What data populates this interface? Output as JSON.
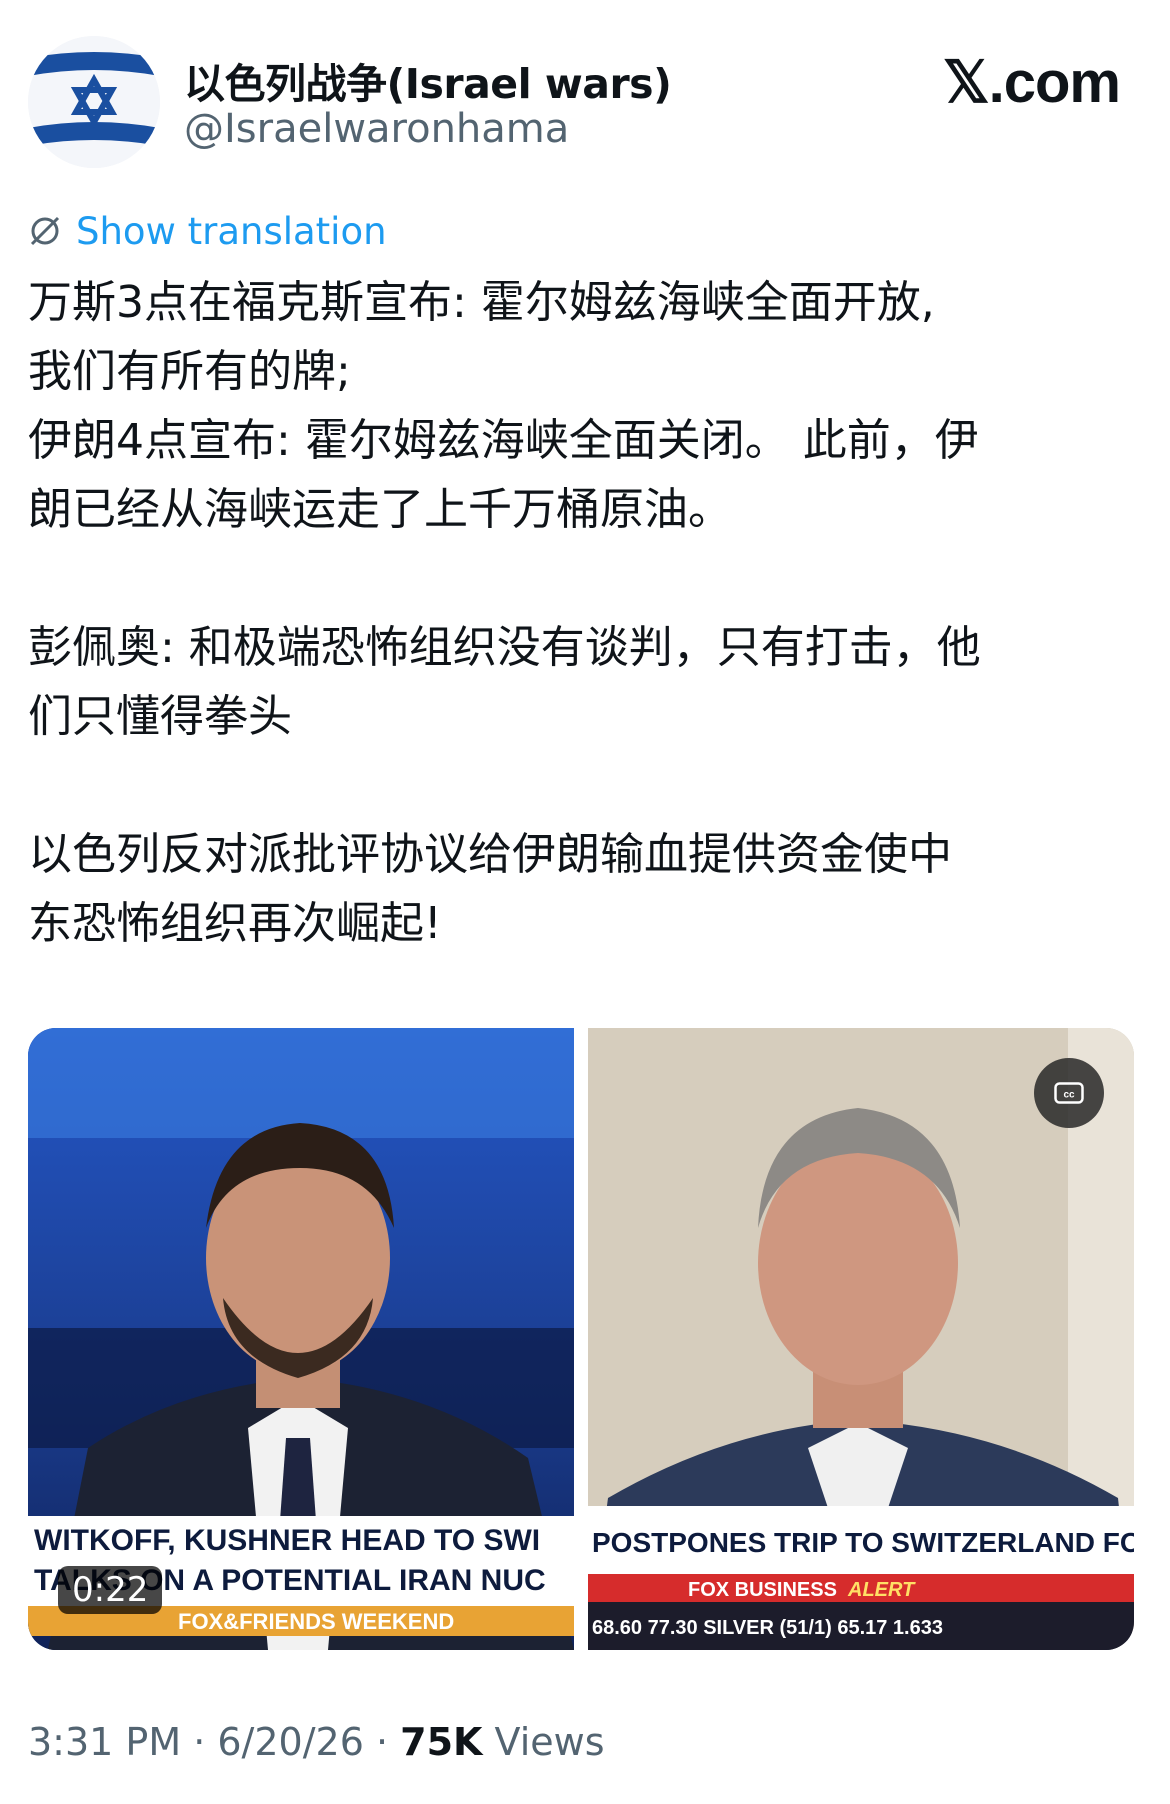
{
  "header": {
    "display_name": "以色列战争(Israel wars)",
    "handle": "@Israelwaronhama",
    "site": "𝕏.com",
    "avatar_icon": "israel-flag-icon"
  },
  "translation": {
    "icon": "globe-translate-icon",
    "label": "Show translation"
  },
  "tweet": {
    "lines": [
      "万斯3点在福克斯宣布: 霍尔姆兹海峡全面开放,",
      "我们有所有的牌;",
      "伊朗4点宣布: 霍尔姆兹海峡全面关闭。 此前，伊",
      "朗已经从海峡运走了上千万桶原油。",
      "彭佩奥: 和极端恐怖组织没有谈判，只有打击，他",
      "们只懂得拳头",
      "以色列反对派批评协议给伊朗输血提供资金使中",
      "东恐怖组织再次崛起!"
    ]
  },
  "media": {
    "left": {
      "ticker_line1": "WITKOFF, KUSHNER HEAD TO SWI",
      "ticker_line2": "TALKS ON A POTENTIAL IRAN NUC",
      "show_name": "FOX&FRIENDS WEEKEND",
      "duration": "0:22"
    },
    "right": {
      "headline": "POSTPONES TRIP TO SWITZERLAND FOR IRAN TALK",
      "network": "FOX BUSINESS",
      "alert": "ALERT",
      "ticker": "68.60  77.30  SILVER (51/1) 65.17  1.633",
      "cc_icon": "closed-captions-icon"
    }
  },
  "meta": {
    "time": "3:31 PM",
    "separator1": " · ",
    "date": "6/20/26",
    "separator2": " · ",
    "views_count": "75K",
    "views_label": " Views"
  },
  "colors": {
    "link": "#1d9bf0",
    "secondary_text": "#536471",
    "primary_text": "#0f1419",
    "flag_blue": "#1a4fa0"
  }
}
